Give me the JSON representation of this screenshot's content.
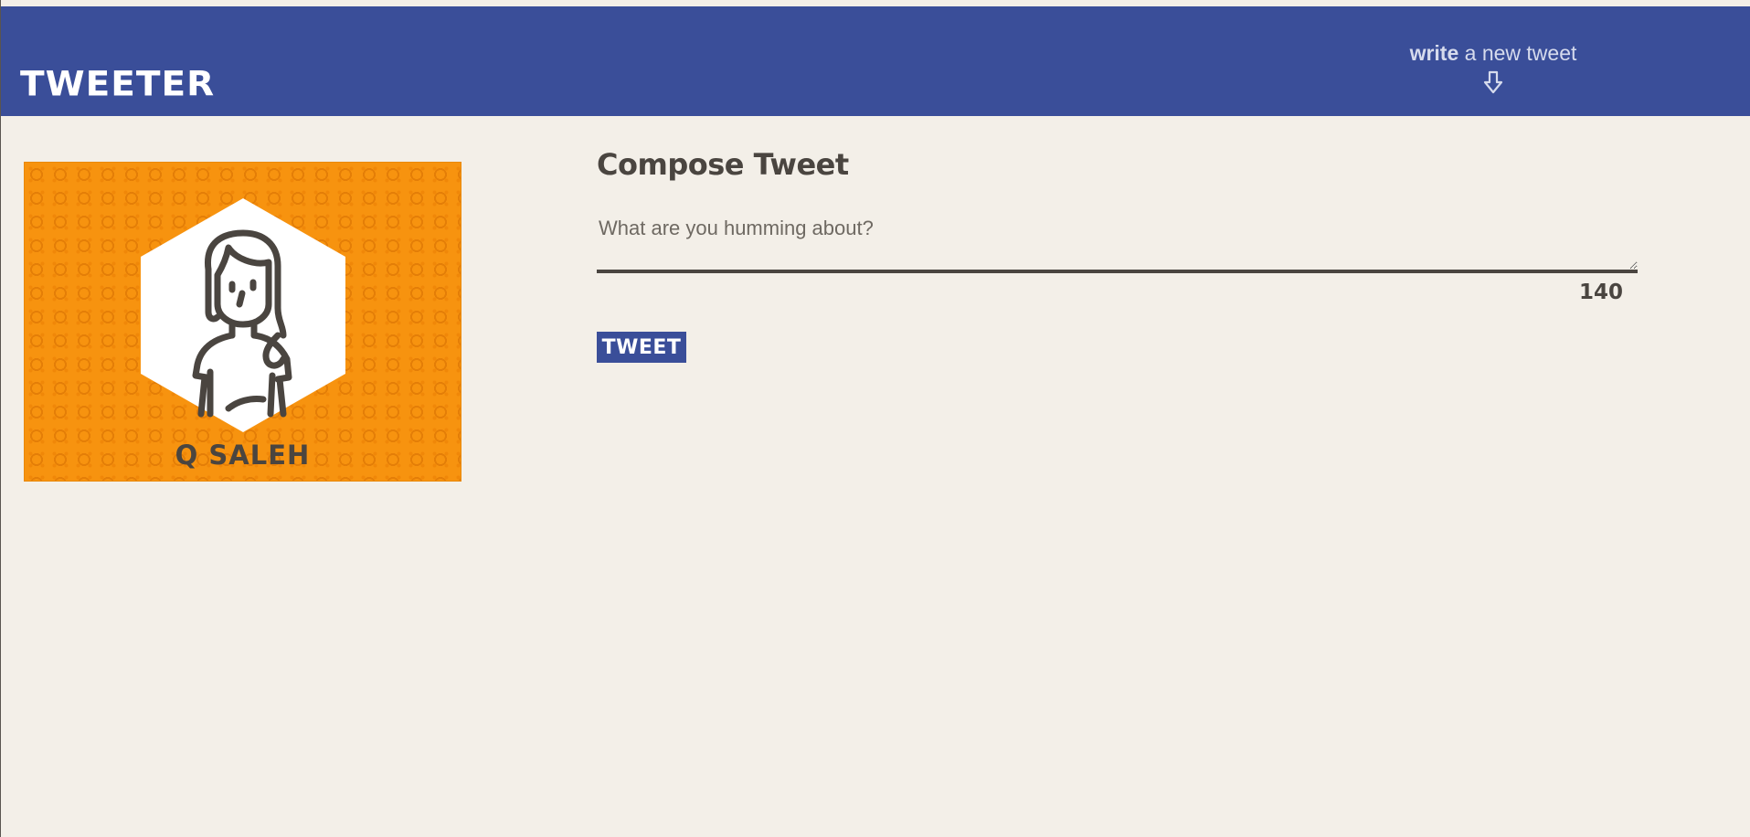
{
  "nav": {
    "brand": "TWEETER",
    "compose_toggle": {
      "bold": "write",
      "rest": " a new tweet",
      "icon": "arrow-down-icon"
    }
  },
  "profile": {
    "name": "Q SALEH",
    "avatar_icon": "person-avatar-icon",
    "background_color": "#f7930f"
  },
  "compose": {
    "title": "Compose Tweet",
    "input_placeholder": "What are you humming about?",
    "input_value": "",
    "counter": "140",
    "button_label": "TWEET"
  },
  "colors": {
    "nav_background": "#3a4e99",
    "page_background": "#f3efe8",
    "text": "#4a4540",
    "accent": "#3a4e99"
  }
}
